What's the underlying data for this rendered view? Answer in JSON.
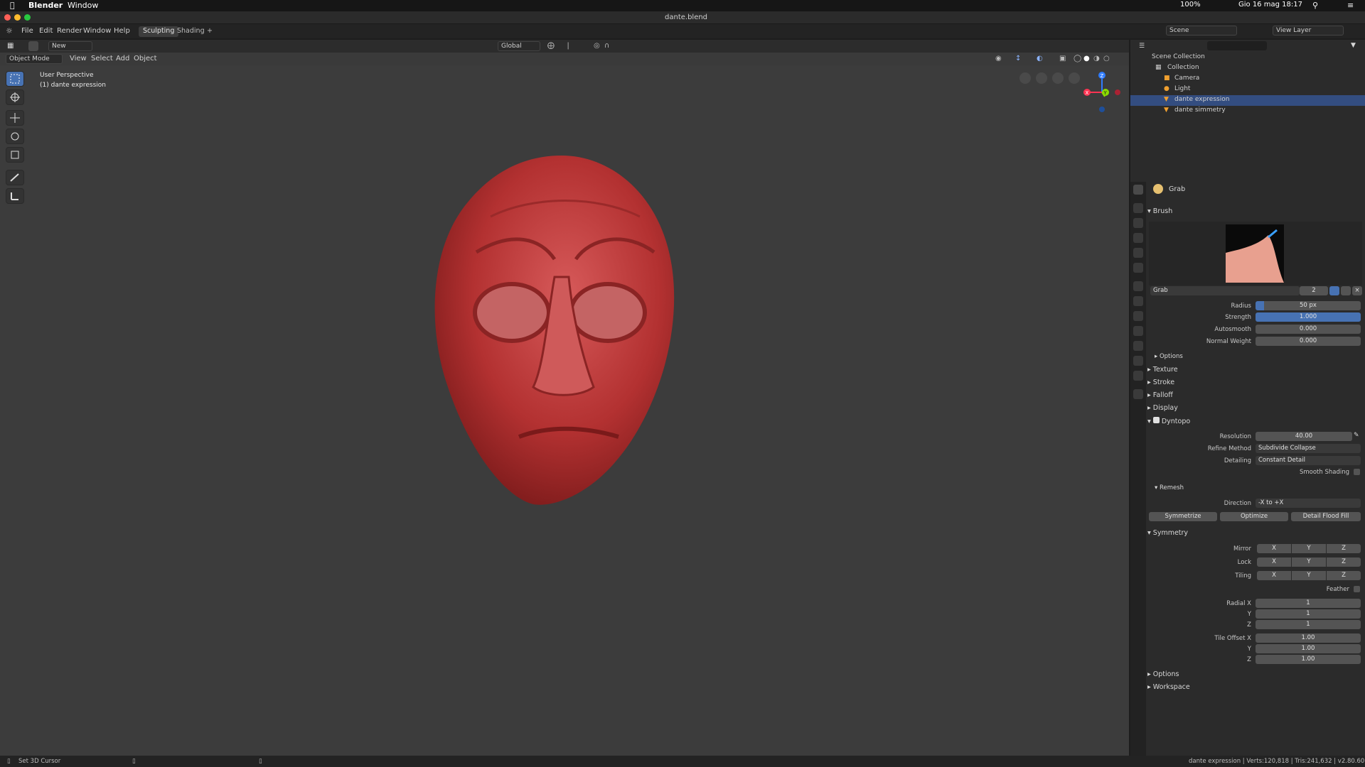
{
  "mac_menubar": {
    "app_name": "Blender",
    "menu": "Window",
    "battery": "100%",
    "datetime": "Gio 16 mag  18:17"
  },
  "window": {
    "title": "dante.blend"
  },
  "topbar": {
    "menus": [
      "File",
      "Edit",
      "Render",
      "Window",
      "Help"
    ],
    "workspaces": [
      "Sculpting",
      "Shading"
    ],
    "active_workspace": "Sculpting",
    "add_tab": "+",
    "scene": "Scene",
    "view_layer": "View Layer"
  },
  "viewport_toolbar": {
    "brush_name": "New",
    "transform_orientation": "Global"
  },
  "viewport_header": {
    "mode": "Object Mode",
    "menus": [
      "View",
      "Select",
      "Add",
      "Object"
    ]
  },
  "viewport": {
    "perspective_label": "User Perspective",
    "object_label": "(1) dante expression",
    "gizmo": {
      "x": "X",
      "y": "Y",
      "z": "Z"
    }
  },
  "outliner": {
    "root": "Scene Collection",
    "collection": "Collection",
    "items": [
      "Camera",
      "Light",
      "dante expression",
      "dante simmetry"
    ],
    "selected": "dante expression"
  },
  "properties": {
    "tool_name": "Grab",
    "brush_section": "Brush",
    "brush_name": "Grab",
    "brush_users": "2",
    "radius_label": "Radius",
    "radius_value": "50 px",
    "strength_label": "Strength",
    "strength_value": "1.000",
    "autosmooth_label": "Autosmooth",
    "autosmooth_value": "0.000",
    "normal_weight_label": "Normal Weight",
    "normal_weight_value": "0.000",
    "options_sub": "Options",
    "collapsed_sections": [
      "Texture",
      "Stroke",
      "Falloff",
      "Display"
    ],
    "dyntopo": {
      "label": "Dyntopo",
      "resolution_label": "Resolution",
      "resolution_value": "40.00",
      "refine_label": "Refine Method",
      "refine_value": "Subdivide Collapse",
      "detailing_label": "Detailing",
      "detailing_value": "Constant Detail",
      "smooth_shading": "Smooth Shading"
    },
    "remesh": {
      "label": "Remesh",
      "direction_label": "Direction",
      "direction_value": "-X to +X",
      "buttons": [
        "Symmetrize",
        "Optimize",
        "Detail Flood Fill"
      ]
    },
    "symmetry": {
      "label": "Symmetry",
      "rows": [
        "Mirror",
        "Lock",
        "Tiling"
      ],
      "axes": [
        "X",
        "Y",
        "Z"
      ],
      "feather": "Feather",
      "radial_labels": [
        "Radial X",
        "Y",
        "Z"
      ],
      "radial_values": [
        "1",
        "1",
        "1"
      ],
      "tile_labels": [
        "Tile Offset X",
        "Y",
        "Z"
      ],
      "tile_values": [
        "1.00",
        "1.00",
        "1.00"
      ]
    },
    "bottom_sections": [
      "Options",
      "Workspace"
    ]
  },
  "statusbar": {
    "left": "Set 3D Cursor",
    "right": "dante expression | Verts:120,818 | Tris:241,632 | v2.80.60"
  },
  "colors": {
    "accent": "#4772b3",
    "head": "#b03030",
    "viewport_bg": "#3c3c3c"
  }
}
